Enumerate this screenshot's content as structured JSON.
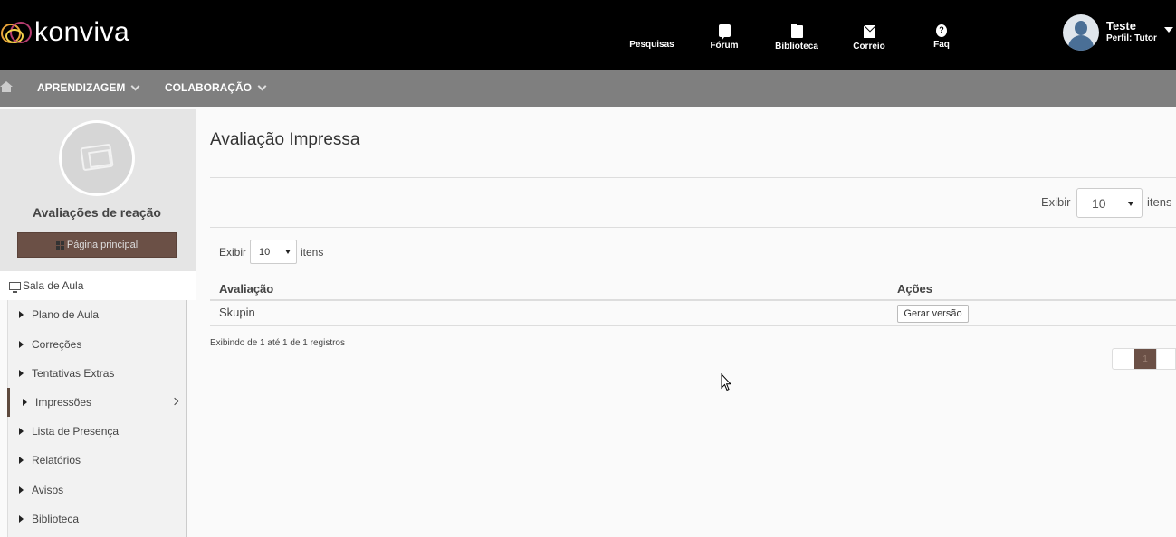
{
  "header": {
    "logo_text": "konviva",
    "nav": [
      {
        "label": "Pesquisas",
        "icon": "search-icon"
      },
      {
        "label": "Fórum",
        "icon": "chat-icon"
      },
      {
        "label": "Biblioteca",
        "icon": "folder-icon"
      },
      {
        "label": "Correio",
        "icon": "mail-icon"
      },
      {
        "label": "Faq",
        "icon": "question-icon"
      }
    ],
    "faq_glyph": "?",
    "user": {
      "name": "Teste",
      "role": "Perfil: Tutor"
    }
  },
  "navbar": {
    "items": [
      {
        "label": "APRENDIZAGEM"
      },
      {
        "label": "COLABORAÇÃO"
      }
    ]
  },
  "sidebar": {
    "title": "Avaliações de reação",
    "main_button": "Página principal",
    "section": "Sala de Aula",
    "items": [
      {
        "label": "Plano de Aula"
      },
      {
        "label": "Correções"
      },
      {
        "label": "Tentativas Extras"
      },
      {
        "label": "Impressões",
        "active": true
      },
      {
        "label": "Lista de Presença"
      },
      {
        "label": "Relatórios"
      },
      {
        "label": "Avisos"
      },
      {
        "label": "Biblioteca"
      }
    ]
  },
  "main": {
    "title": "Avaliação Impressa",
    "outer_length": {
      "label": "Exibir",
      "value": "10",
      "suffix": "itens"
    },
    "inner_length": {
      "label": "Exibir",
      "value": "10",
      "suffix": "itens"
    },
    "table": {
      "columns": [
        "Avaliação",
        "Ações"
      ],
      "rows": [
        {
          "avaliacao": "Skupin",
          "action": "Gerar versão"
        }
      ]
    },
    "info": "Exibindo de 1 até 1 de 1 registros",
    "pagination": {
      "current": "1"
    }
  },
  "colors": {
    "topbar": "#000000",
    "navbar": "#7f7f7f",
    "accent": "#6b5046"
  }
}
